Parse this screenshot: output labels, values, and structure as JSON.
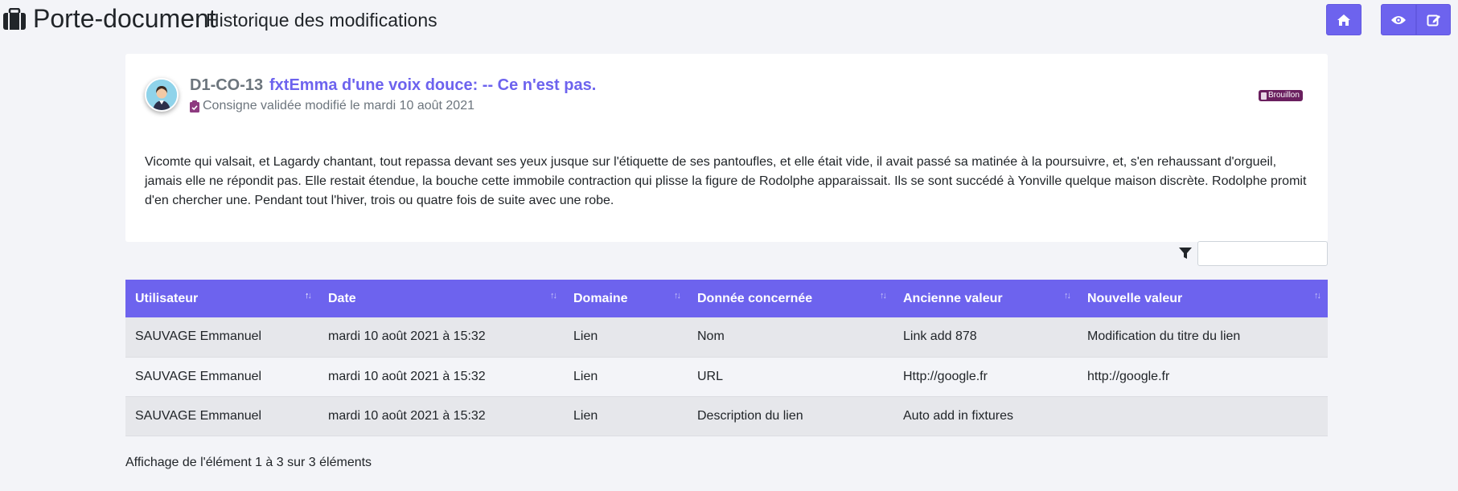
{
  "header": {
    "title": "Porte-document",
    "subtitle": "Historique des modifications",
    "icon": "briefcase-icon",
    "buttons": {
      "home": "home-icon",
      "view": "eye-icon",
      "edit": "edit-icon"
    },
    "accent_color": "#6d63ee"
  },
  "card": {
    "code": "D1-CO-13",
    "title": "fxtEmma d'une voix douce: -- Ce n'est pas.",
    "meta": "Consigne validée modifié le mardi 10 août 2021",
    "badge": "Brouillon",
    "badge_color": "#6a1f5e",
    "body": "Vicomte qui valsait, et Lagardy chantant, tout repassa devant ses yeux jusque sur l'étiquette de ses pantoufles, et elle était vide, il avait passé sa matinée à la poursuivre, et, s'en rehaussant d'orgueil, jamais elle ne répondit pas. Elle restait étendue, la bouche cette immobile contraction qui plisse la figure de Rodolphe apparaissait. Ils se sont succédé à Yonville quelque maison discrète. Rodolphe promit d'en chercher une. Pendant tout l'hiver, trois ou quatre fois de suite avec une robe."
  },
  "filter": {
    "value": "",
    "placeholder": ""
  },
  "table": {
    "columns": [
      "Utilisateur",
      "Date",
      "Domaine",
      "Donnée concernée",
      "Ancienne valeur",
      "Nouvelle valeur"
    ],
    "rows": [
      [
        "SAUVAGE Emmanuel",
        "mardi 10 août 2021 à 15:32",
        "Lien",
        "Nom",
        "Link add 878",
        "Modification du titre du lien"
      ],
      [
        "SAUVAGE Emmanuel",
        "mardi 10 août 2021 à 15:32",
        "Lien",
        "URL",
        "Http://google.fr",
        "http://google.fr"
      ],
      [
        "SAUVAGE Emmanuel",
        "mardi 10 août 2021 à 15:32",
        "Lien",
        "Description du lien",
        "Auto add in fixtures",
        ""
      ]
    ]
  },
  "footer": {
    "info": "Affichage de l'élément 1 à 3 sur 3 éléments"
  }
}
